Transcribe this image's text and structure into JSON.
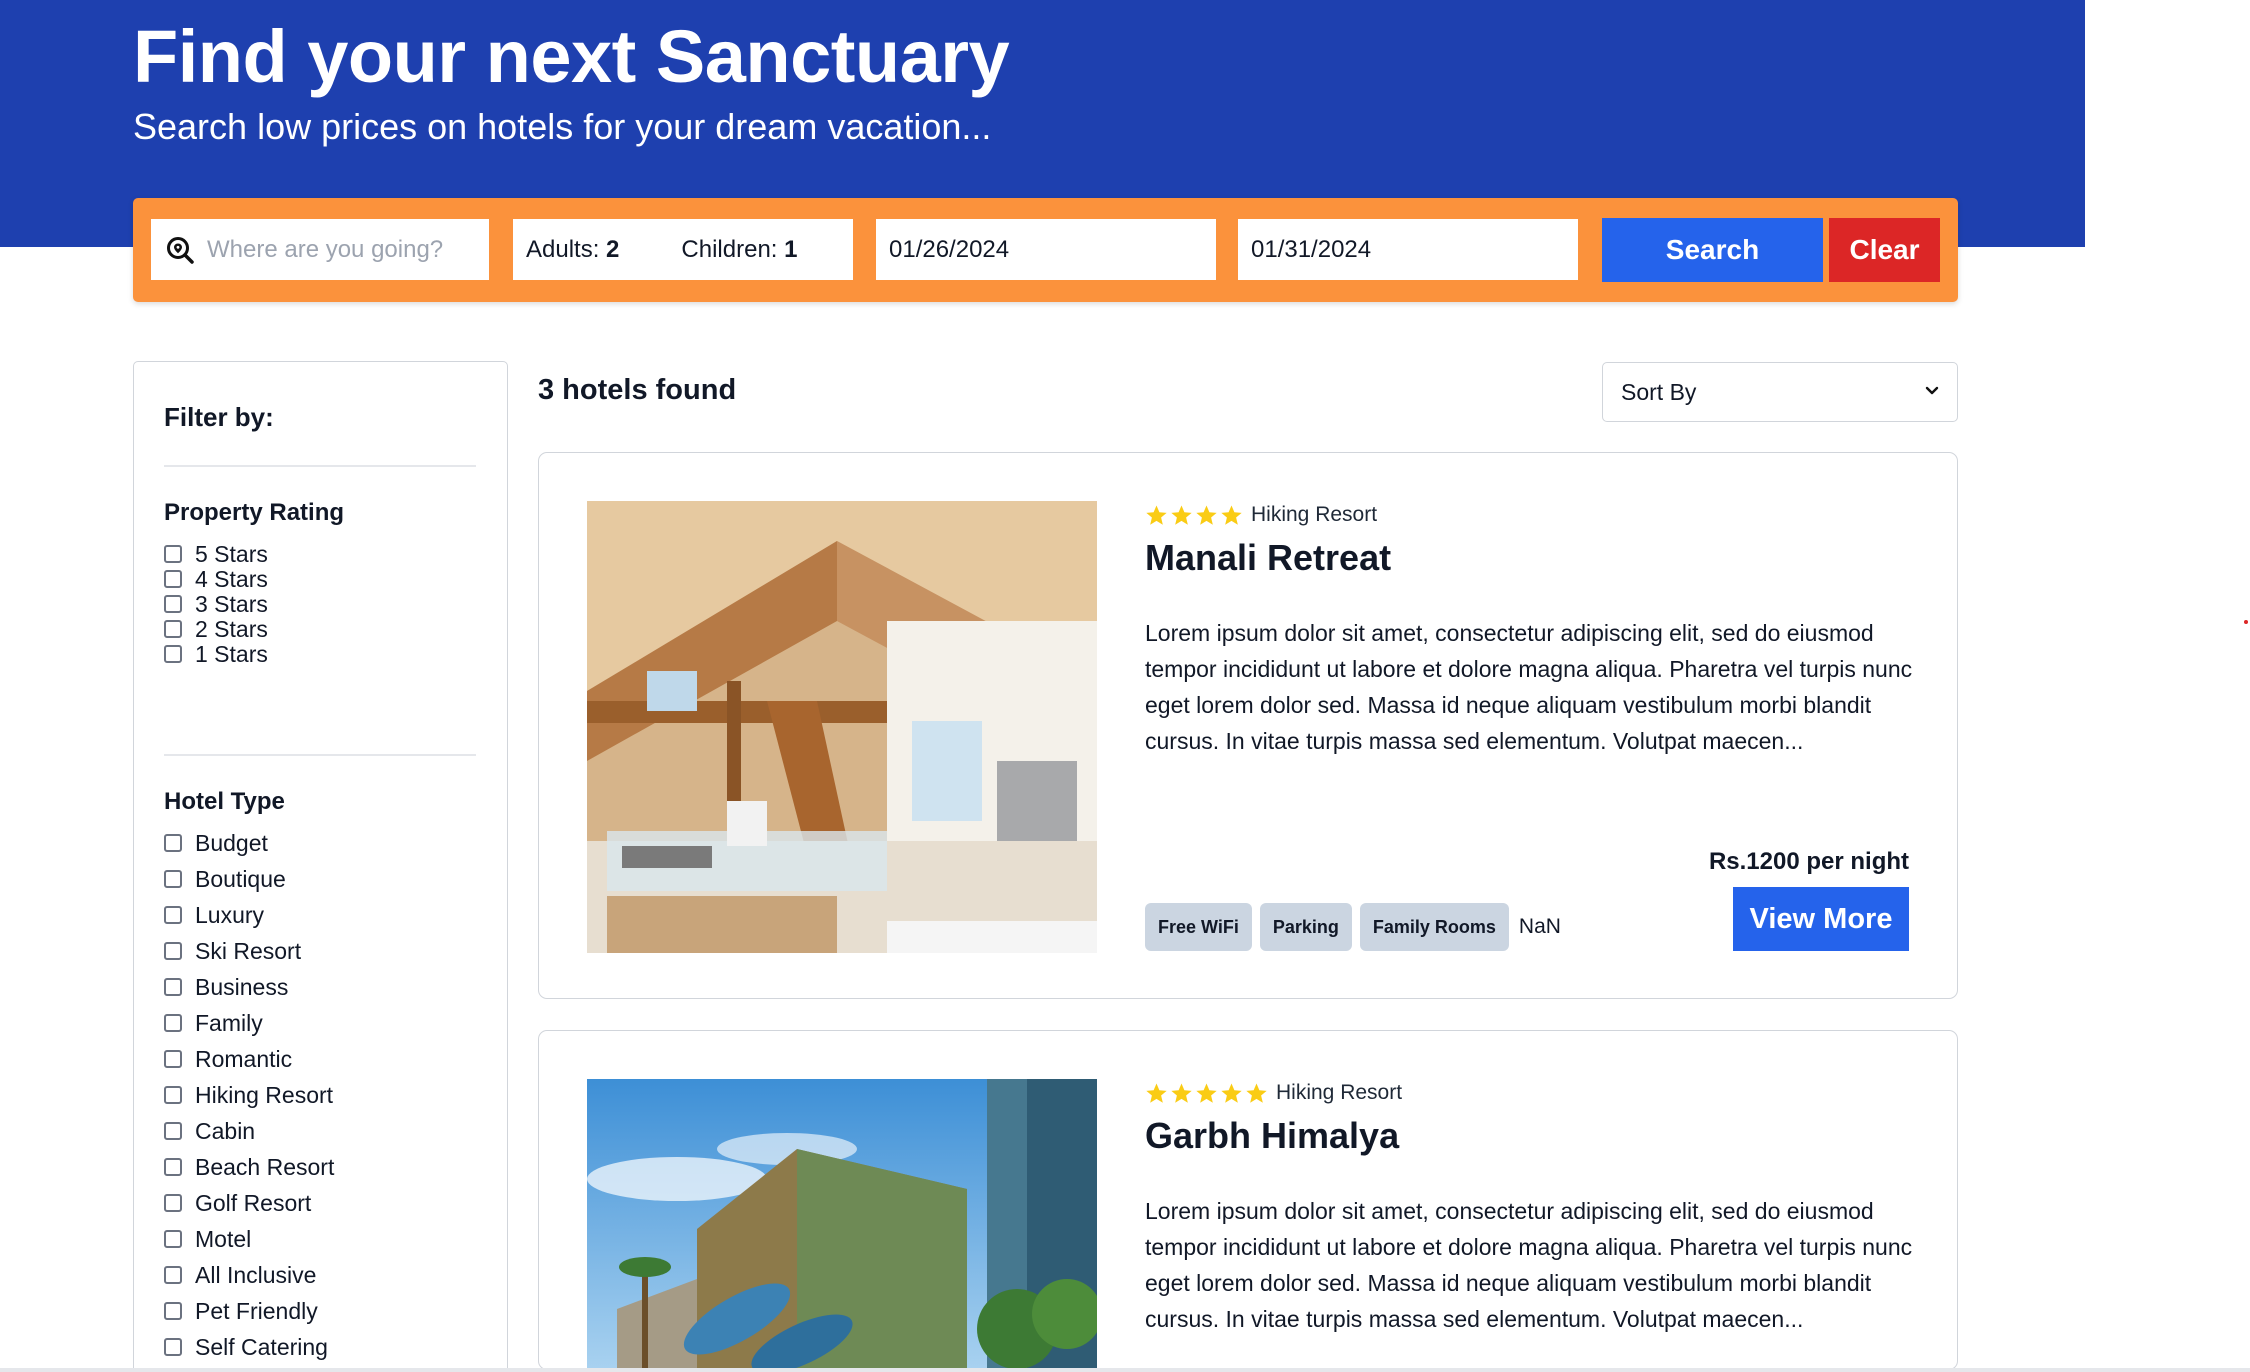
{
  "hero": {
    "title": "Find your next Sanctuary",
    "subtitle": "Search low prices on hotels for your dream vacation..."
  },
  "search": {
    "destination_placeholder": "Where are you going?",
    "destination_icon": "search-location-icon",
    "adults_label": "Adults:",
    "adults_value": "2",
    "children_label": "Children:",
    "children_value": "1",
    "check_in": "01/26/2024",
    "check_out": "01/31/2024",
    "search_label": "Search",
    "clear_label": "Clear"
  },
  "filters": {
    "title": "Filter by:",
    "rating": {
      "title": "Property Rating",
      "options": [
        "5 Stars",
        "4 Stars",
        "3 Stars",
        "2 Stars",
        "1 Stars"
      ]
    },
    "hotel_type": {
      "title": "Hotel Type",
      "options": [
        "Budget",
        "Boutique",
        "Luxury",
        "Ski Resort",
        "Business",
        "Family",
        "Romantic",
        "Hiking Resort",
        "Cabin",
        "Beach Resort",
        "Golf Resort",
        "Motel",
        "All Inclusive",
        "Pet Friendly",
        "Self Catering"
      ]
    }
  },
  "results": {
    "count_text": "3 hotels found",
    "sort_label": "Sort By"
  },
  "hotels": [
    {
      "name": "Manali Retreat",
      "type": "Hiking Resort",
      "rating": 4,
      "description": "Lorem ipsum dolor sit amet, consectetur adipiscing elit, sed do eiusmod tempor incididunt ut labore et dolore magna aliqua. Pharetra vel turpis nunc eget lorem dolor sed. Massa id neque aliquam vestibulum morbi blandit cursus. In vitae turpis massa sed elementum. Volutpat maecen...",
      "price": "Rs.1200 per night",
      "facilities": [
        "Free WiFi",
        "Parking",
        "Family Rooms"
      ],
      "facilities_extra": "NaN",
      "button_label": "View More"
    },
    {
      "name": "Garbh Himalya",
      "type": "Hiking Resort",
      "rating": 5,
      "description": "Lorem ipsum dolor sit amet, consectetur adipiscing elit, sed do eiusmod tempor incididunt ut labore et dolore magna aliqua. Pharetra vel turpis nunc eget lorem dolor sed. Massa id neque aliquam vestibulum morbi blandit cursus. In vitae turpis massa sed elementum. Volutpat maecen..."
    }
  ],
  "colors": {
    "hero_bg": "#1e40af",
    "search_bar": "#fb923c",
    "primary_button": "#2563eb",
    "clear_button": "#dc2626",
    "star": "#facc15",
    "tag_bg": "#cbd5e1"
  }
}
